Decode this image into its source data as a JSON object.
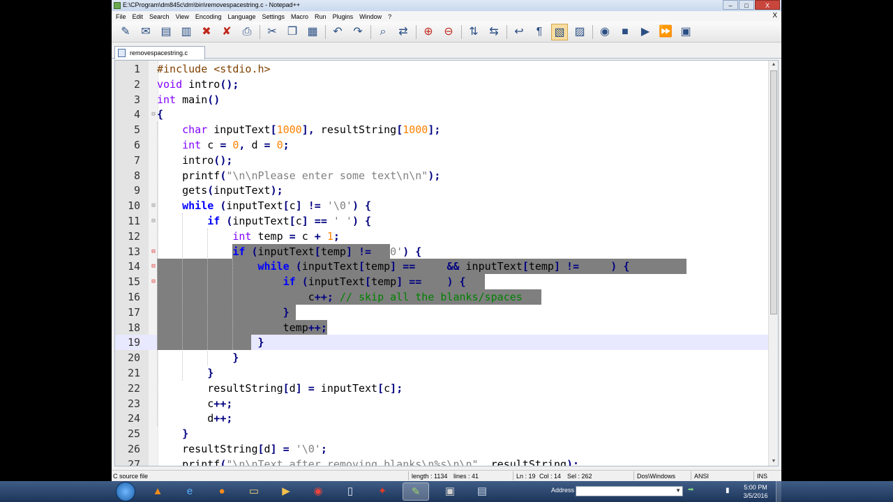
{
  "window": {
    "title": "E:\\CProgram\\dm845c\\dm\\bin\\removespacestring.c - Notepad++",
    "min": "–",
    "max": "□",
    "close": "X"
  },
  "menu": [
    "File",
    "Edit",
    "Search",
    "View",
    "Encoding",
    "Language",
    "Settings",
    "Macro",
    "Run",
    "Plugins",
    "Window",
    "?"
  ],
  "menu_close": "X",
  "tab": {
    "label": "removespacestring.c"
  },
  "toolbar_icons": [
    "new-file-icon",
    "open-file-icon",
    "save-icon",
    "save-all-icon",
    "close-icon",
    "close-all-icon",
    "print-icon",
    "cut-icon",
    "copy-icon",
    "paste-icon",
    "undo-icon",
    "redo-icon",
    "find-icon",
    "replace-icon",
    "zoom-in-icon",
    "zoom-out-icon",
    "sync-vertical-icon",
    "sync-horizontal-icon",
    "word-wrap-icon",
    "show-all-chars-icon",
    "indent-guide-icon",
    "document-map-icon",
    "record-macro-icon",
    "stop-macro-icon",
    "play-macro-icon",
    "run-macro-multiple-icon",
    "save-macro-icon"
  ],
  "code": [
    "#include <stdio.h>",
    "void intro();",
    "int main()",
    "{",
    "    char inputText[1000], resultString[1000];",
    "    int c = 0, d = 0;",
    "    intro();",
    "    printf(\"\\n\\nPlease enter some text\\n\\n\");",
    "    gets(inputText);",
    "    while (inputText[c] != '\\0') {",
    "        if (inputText[c] == ' ') {",
    "            int temp = c + 1;",
    "            if (inputText[temp] != '\\0') {",
    "                while (inputText[temp] == ' ' && inputText[temp] != '\\0') {",
    "                    if (inputText[temp] == ' ') {",
    "                        c++; // skip all the blanks/spaces",
    "                    }",
    "                    temp++;",
    "                }",
    "            }",
    "        }",
    "        resultString[d] = inputText[c];",
    "        c++;",
    "        d++;",
    "    }",
    "    resultString[d] = '\\0';",
    "    printf(\"\\n\\nText after removing blanks\\n%s\\n\\n\", resultString);"
  ],
  "status": {
    "type": "C source file",
    "length": "length : 1134",
    "lines": "lines : 41",
    "ln": "Ln : 19",
    "col": "Col : 14",
    "sel": "Sel : 262",
    "eol": "Dos\\Windows",
    "enc": "ANSI",
    "mode": "INS"
  },
  "taskbar": {
    "address_label": "Address",
    "time": "5:00 PM",
    "date": "3/5/2016"
  }
}
